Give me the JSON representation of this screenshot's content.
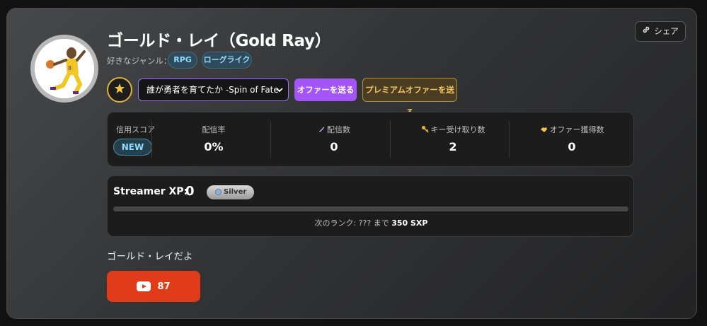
{
  "profile": {
    "name": "ゴールド・レイ（Gold Ray）",
    "genre_label": "好きなジャンル：",
    "genres": [
      "RPG",
      "ローグライク"
    ],
    "bio": "ゴールド・レイだよ"
  },
  "actions": {
    "share_label": "シェア",
    "game_select_value": "誰が勇者を育てたか -Spin of Fate-",
    "offer_label": "オファーを送る",
    "premium_offer_label": "プレミアムオファーを送る"
  },
  "stats": {
    "credit_label": "信用スコア",
    "credit_badge": "NEW",
    "items": [
      {
        "label": "配信率",
        "value": "0%",
        "icon": ""
      },
      {
        "label": "配信数",
        "value": "0",
        "icon": "pencil-icon"
      },
      {
        "label": "キー受け取り数",
        "value": "2",
        "icon": "key-icon"
      },
      {
        "label": "オファー獲得数",
        "value": "0",
        "icon": "handshake-icon"
      }
    ]
  },
  "xp": {
    "label": "Streamer XP:",
    "value": "0",
    "rank": "Silver",
    "progress": 0,
    "next_rank_prefix": "次のランク: ??? まで",
    "next_rank_amount": "350 SXP"
  },
  "youtube": {
    "count": "87",
    "color": "#e03c19"
  },
  "colors": {
    "accent_purple": "#a355f7",
    "premium_gold": "#f1c566",
    "tag_text": "#8fdcff"
  }
}
